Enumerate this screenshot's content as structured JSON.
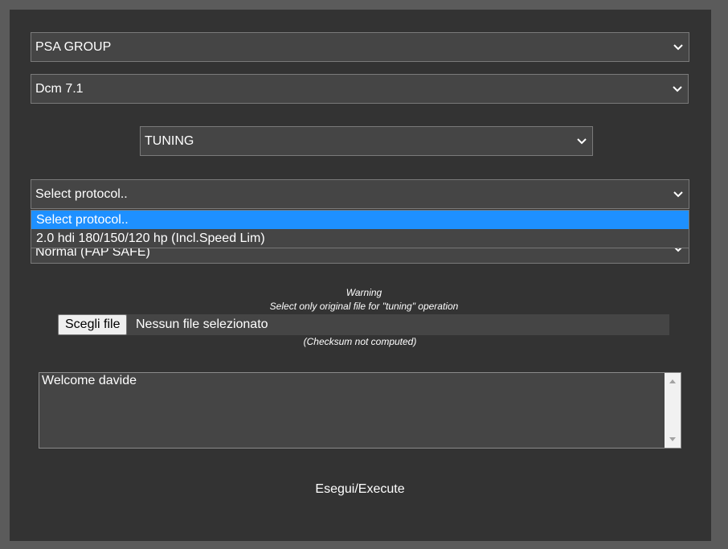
{
  "manufacturer_select": {
    "value": "PSA GROUP",
    "icon": "chevron-down-icon"
  },
  "ecu_select": {
    "value": "Dcm 7.1"
  },
  "mode_select": {
    "value": "TUNING"
  },
  "protocol_select": {
    "value": "Select protocol..",
    "options": [
      {
        "label": "Select protocol.."
      },
      {
        "label": "2.0 hdi 180/150/120 hp (Incl.Speed Lim)"
      }
    ],
    "highlight_color": "#1e90ff"
  },
  "hidden_select": {
    "partial_value": "Normal (FAP SAFE)"
  },
  "warning": {
    "title": "Warning",
    "message": "Select only original file for \"tuning\" operation"
  },
  "file_input": {
    "button_label": "Scegli file",
    "status": "Nessun file selezionato"
  },
  "checksum_note": "(Checksum not computed)",
  "log": {
    "text": "Welcome davide"
  },
  "execute_label": "Esegui/Execute"
}
